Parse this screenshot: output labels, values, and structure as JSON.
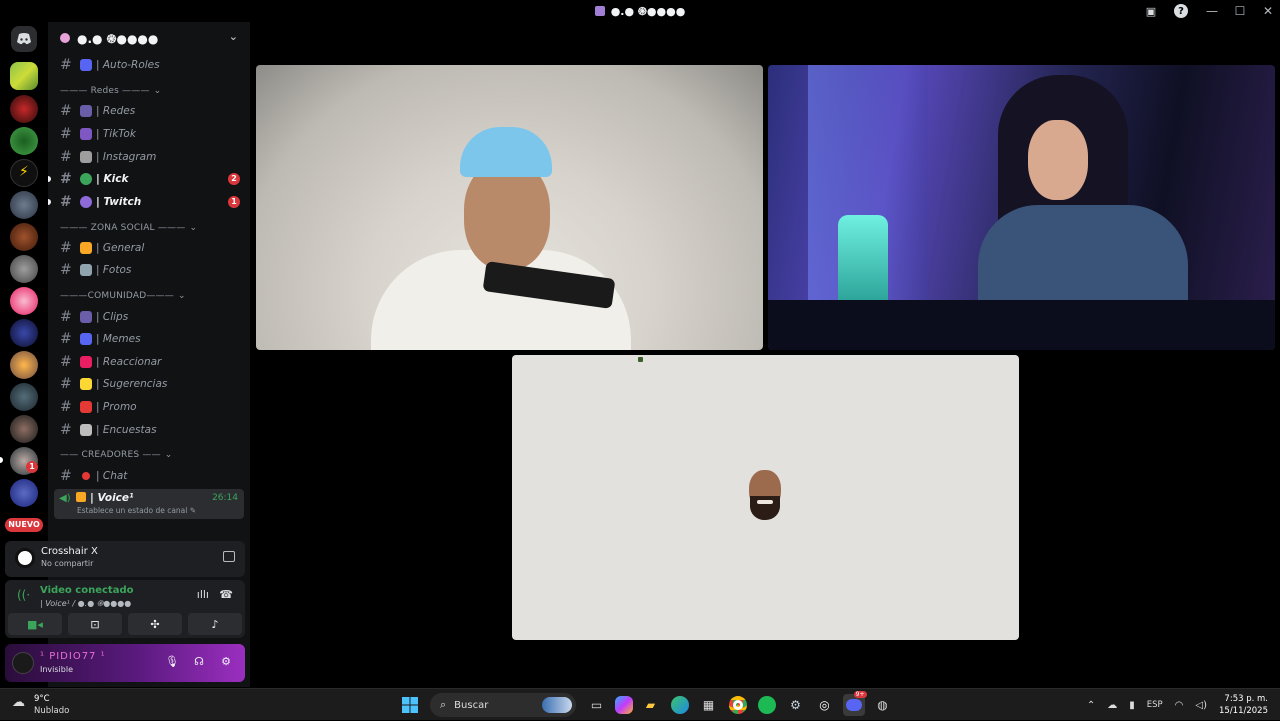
{
  "window": {
    "title": "●.● ֎●●●●",
    "controls": {
      "minimize": "—",
      "maximize": "☐",
      "close": "✕"
    }
  },
  "server": {
    "name": "●.● ֎●●●●",
    "nuevo_label": "NUEVO",
    "rail_badges": [
      "1"
    ]
  },
  "channels": {
    "top": [
      {
        "name": "| Auto-Roles"
      }
    ],
    "categories": [
      {
        "label": "——— Redes ———",
        "items": [
          {
            "name": "| Redes"
          },
          {
            "name": "| TikTok"
          },
          {
            "name": "| Instagram"
          },
          {
            "name": "| Kick",
            "unread": "2",
            "bold": true
          },
          {
            "name": "| Twitch",
            "unread": "1",
            "bold": true
          }
        ]
      },
      {
        "label": "——— ZONA SOCIAL ———",
        "items": [
          {
            "name": "| General"
          },
          {
            "name": "| Fotos"
          }
        ]
      },
      {
        "label": "———COMUNIDAD———",
        "items": [
          {
            "name": "| Clips"
          },
          {
            "name": "| Memes"
          },
          {
            "name": "| Reaccionar"
          },
          {
            "name": "| Sugerencias"
          },
          {
            "name": "| Promo"
          },
          {
            "name": "| Encuestas"
          }
        ]
      },
      {
        "label": "—— CREADORES ——",
        "items": [
          {
            "name": "| Chat"
          }
        ]
      }
    ],
    "voice": {
      "name": "| Voice¹",
      "time": "26:14",
      "status": "Establece un estado de canal"
    }
  },
  "activity": {
    "name": "Crosshair X",
    "sub": "No compartir"
  },
  "voice_panel": {
    "title": "Video conectado",
    "sub": "| Voice¹ / ●.● ֎●●●●"
  },
  "user": {
    "name": "¹ PIDIO77 ¹",
    "status": "Invisible"
  },
  "taskbar": {
    "weather_temp": "9°C",
    "weather_desc": "Nublado",
    "search_placeholder": "Buscar",
    "lang": "ESP",
    "time": "7:53 p. m.",
    "date": "15/11/2025",
    "discord_badge": "9+"
  },
  "colors": {
    "accent_green": "#3ba55c",
    "badge_red": "#da373c",
    "sidebar_bg": "#111214"
  }
}
